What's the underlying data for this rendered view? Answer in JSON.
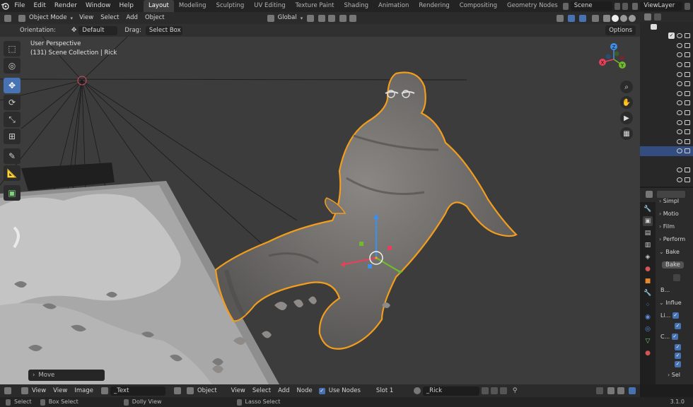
{
  "topbar": {
    "menus": [
      "File",
      "Edit",
      "Render",
      "Window",
      "Help"
    ],
    "workspaces": [
      "Layout",
      "Modeling",
      "Sculpting",
      "UV Editing",
      "Texture Paint",
      "Shading",
      "Animation",
      "Rendering",
      "Compositing",
      "Geometry Nodes"
    ],
    "active_workspace": "Layout",
    "scene": "Scene",
    "view_layer": "ViewLayer"
  },
  "viewport_header": {
    "mode": "Object Mode",
    "menus": [
      "View",
      "Select",
      "Add",
      "Object"
    ],
    "transform_orientation": "Global"
  },
  "tool_settings": {
    "orientation_label": "Orientation:",
    "orientation_value": "Default",
    "drag_label": "Drag:",
    "drag_value": "Select Box",
    "options": "Options"
  },
  "viewport": {
    "perspective": "User Perspective",
    "collection_info": "(131) Scene Collection | Rick",
    "last_operator": "Move",
    "gizmo_axes": [
      "X",
      "Y",
      "Z"
    ]
  },
  "properties": {
    "rows": [
      "Simpl",
      "Motio",
      "Film",
      "Perform",
      "Bake",
      "Bake",
      "B...",
      "Influe",
      "Li...",
      "C...",
      "Sel"
    ]
  },
  "bottom_header": {
    "editor_menus": [
      "View",
      "View",
      "Image"
    ],
    "image_name": "_Text",
    "object_label": "Object",
    "node_menus": [
      "View",
      "Select",
      "Add",
      "Node"
    ],
    "use_nodes": "Use Nodes",
    "slot": "Slot 1",
    "material": "_Rick"
  },
  "statusbar": {
    "select": "Select",
    "box_select": "Box Select",
    "dolly_view": "Dolly View",
    "lasso_select": "Lasso Select",
    "version": "3.1.0"
  },
  "colors": {
    "accent": "#4772b3",
    "selection_outline": "#f29d1d",
    "viewport_bg": "#3c3c3c",
    "axis_x": "#e8405a",
    "axis_y": "#72b92c",
    "axis_z": "#3f8ee8"
  }
}
